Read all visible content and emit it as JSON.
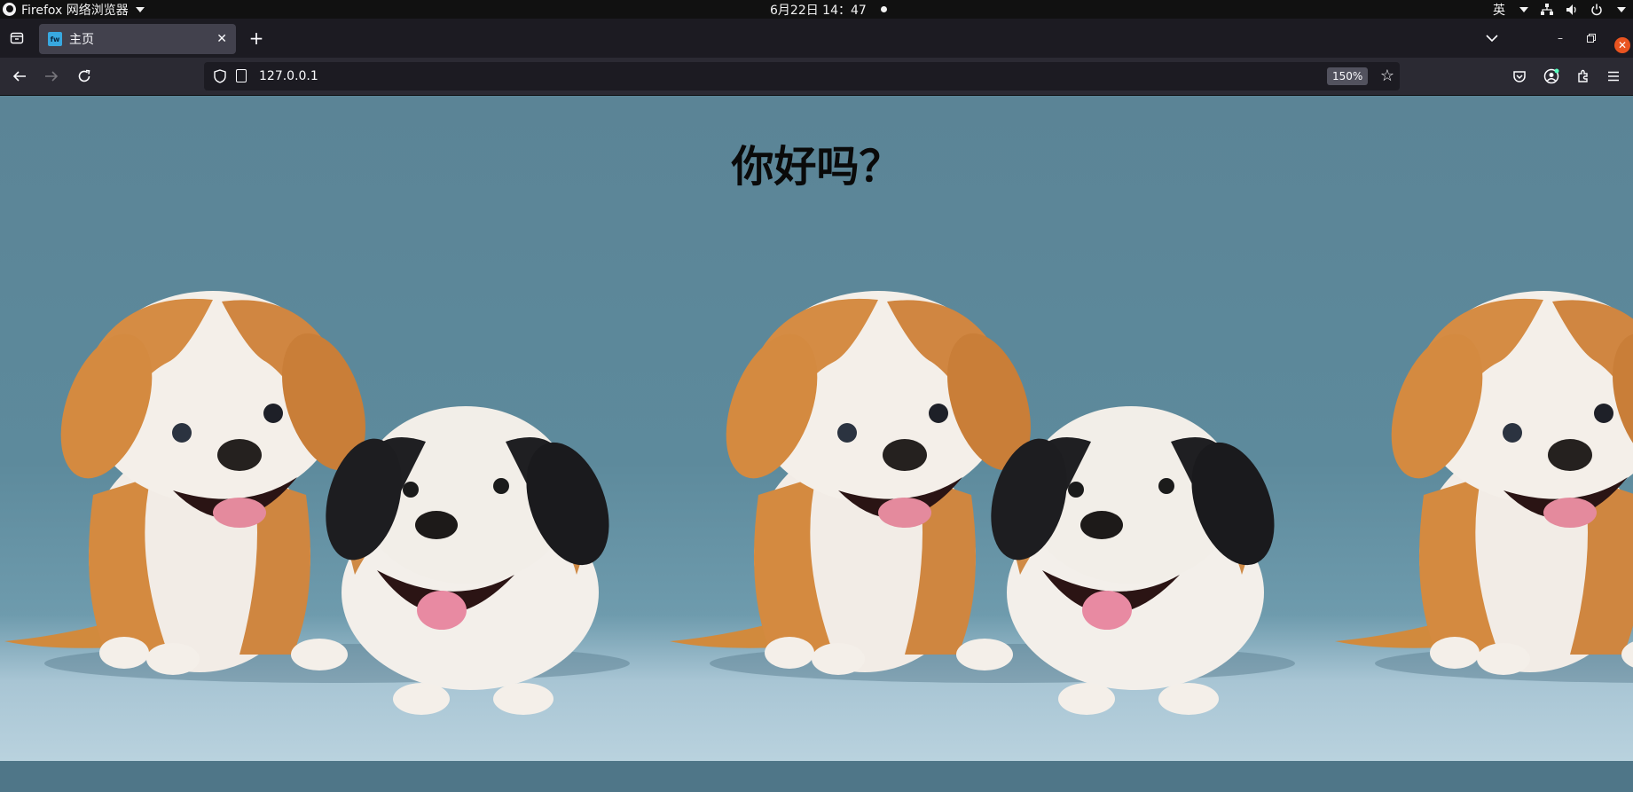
{
  "system_bar": {
    "app_name": "Firefox 网络浏览器",
    "clock": "6月22日  14：47",
    "input_method": "英"
  },
  "browser": {
    "tab_title": "主页",
    "url": "127.0.0.1",
    "zoom": "150%"
  },
  "page": {
    "heading": "你好吗？",
    "image_alt": "two puppies"
  },
  "colors": {
    "accent_close": "#e95420",
    "page_background": "#577a8d"
  }
}
